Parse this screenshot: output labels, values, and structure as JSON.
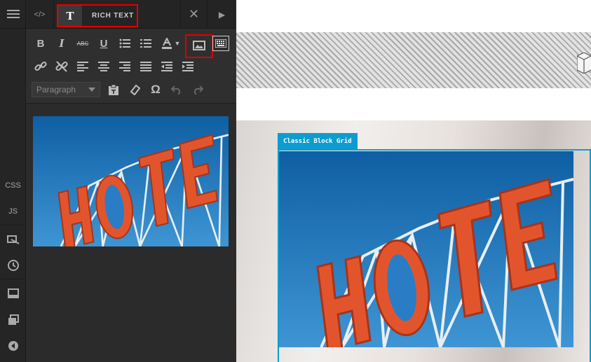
{
  "rail": {
    "menu_icon": "hamburger-icon",
    "css_label": "CSS",
    "js_label": "JS",
    "icons": [
      "layers-icon",
      "history-icon",
      "panel-icon",
      "copy-icon",
      "back-icon"
    ]
  },
  "tabs": {
    "code_label": "</>",
    "rich_text_icon": "T",
    "rich_text_label": "RICH TEXT"
  },
  "toolbar": {
    "format_select": "Paragraph",
    "buttons_row1": [
      "B",
      "I",
      "ABC",
      "U"
    ]
  },
  "canvas": {
    "block_label": "Classic Block Grid"
  },
  "image": {
    "sign_text": "HOTE",
    "sky_color": "#1a6fb3",
    "letter_color": "#e2552c"
  }
}
